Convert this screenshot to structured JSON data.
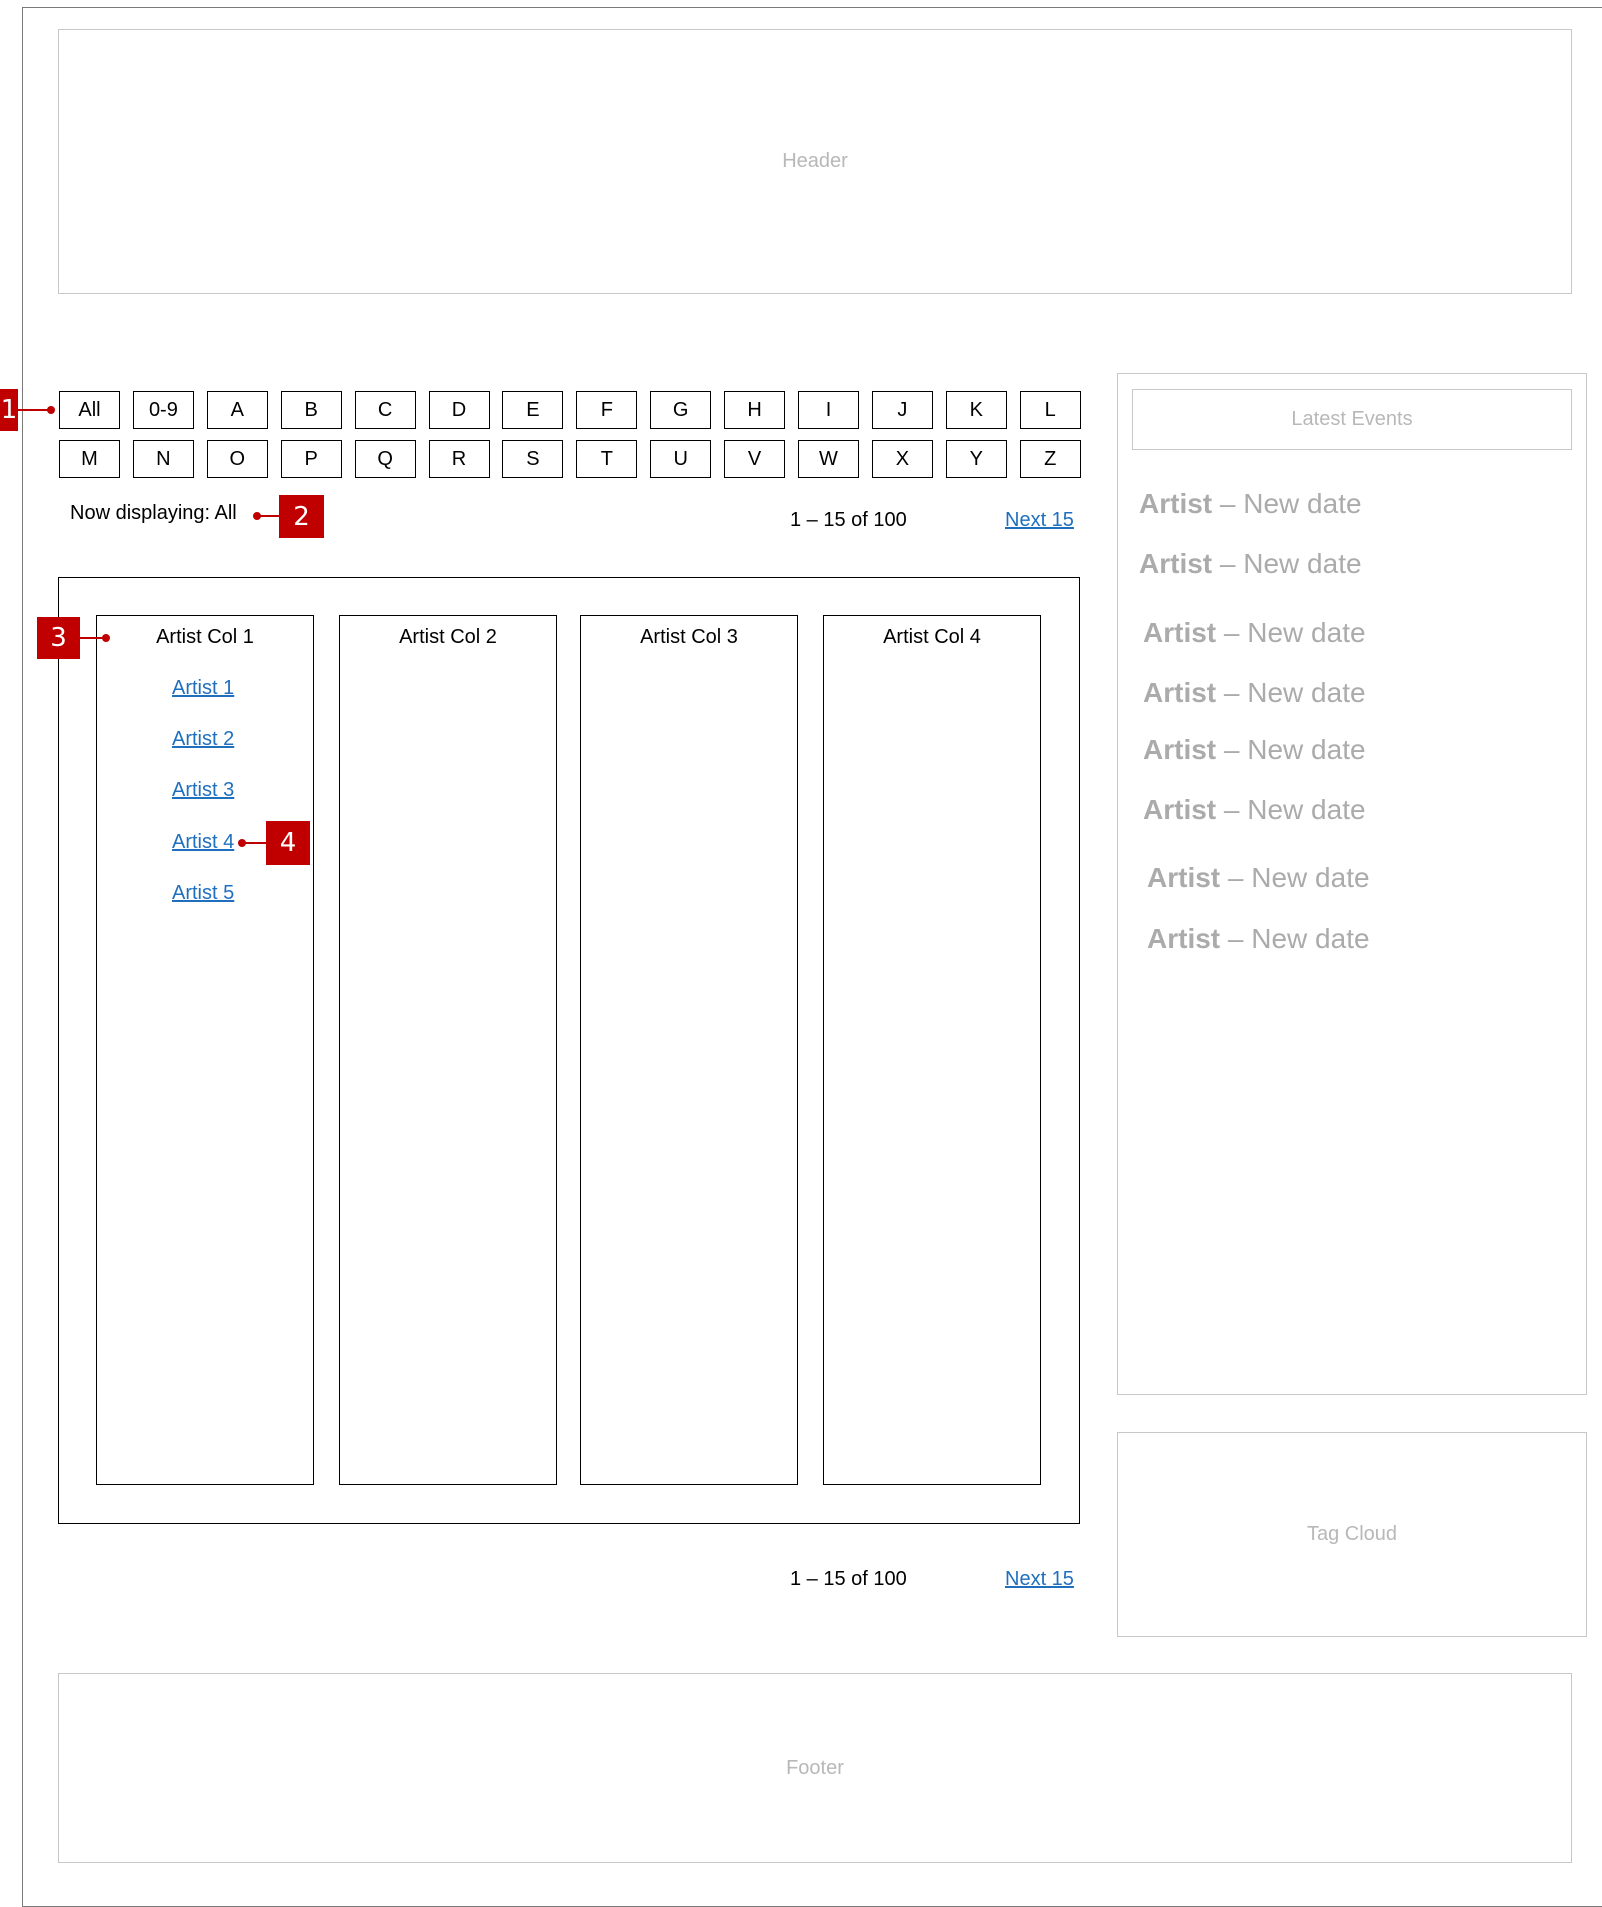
{
  "header": {
    "label": "Header"
  },
  "footer": {
    "label": "Footer"
  },
  "letters_row1": [
    "All",
    "0-9",
    "A",
    "B",
    "C",
    "D",
    "E",
    "F",
    "G",
    "H",
    "I",
    "J",
    "K",
    "L"
  ],
  "letters_row2": [
    "M",
    "N",
    "O",
    "P",
    "Q",
    "R",
    "S",
    "T",
    "U",
    "V",
    "W",
    "X",
    "Y",
    "Z"
  ],
  "status": {
    "now_displaying": "Now displaying: All"
  },
  "pagination": {
    "range": "1 – 15 of 100",
    "next": "Next 15"
  },
  "columns": [
    {
      "title": "Artist Col 1",
      "artists": [
        "Artist 1",
        "Artist 2",
        "Artist 3",
        "Artist 4",
        "Artist 5"
      ]
    },
    {
      "title": "Artist Col 2",
      "artists": []
    },
    {
      "title": "Artist Col 3",
      "artists": []
    },
    {
      "title": "Artist Col 4",
      "artists": []
    }
  ],
  "sidebar": {
    "latest_events_title": "Latest Events",
    "events": [
      {
        "artist": "Artist",
        "sep": " – ",
        "date": "New date"
      },
      {
        "artist": "Artist",
        "sep": " – ",
        "date": "New date"
      },
      {
        "artist": "Artist",
        "sep": " – ",
        "date": "New date"
      },
      {
        "artist": "Artist",
        "sep": " – ",
        "date": "New date"
      },
      {
        "artist": "Artist",
        "sep": " – ",
        "date": "New date"
      },
      {
        "artist": "Artist",
        "sep": " – ",
        "date": "New date"
      },
      {
        "artist": "Artist",
        "sep": " – ",
        "date": "New date"
      },
      {
        "artist": "Artist",
        "sep": " – ",
        "date": "New date"
      }
    ],
    "tag_cloud": "Tag Cloud"
  },
  "annotations": [
    "1",
    "2",
    "3",
    "4"
  ],
  "colors": {
    "link": "#1f6fbf",
    "marker": "#c00000",
    "placeholder_text": "#b8b8b8",
    "event_text": "#ababab"
  }
}
